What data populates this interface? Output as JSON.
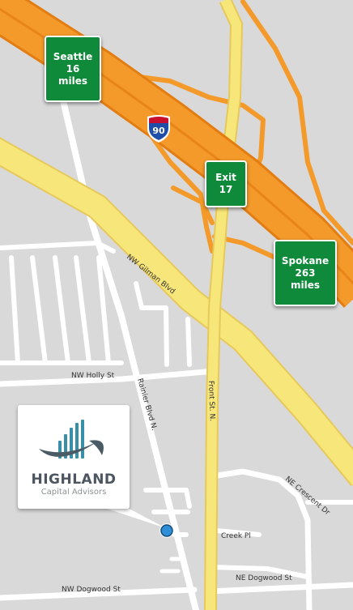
{
  "signs": {
    "seattle": {
      "line1": "Seattle",
      "line2": "16",
      "line3": "miles"
    },
    "exit": {
      "line1": "Exit",
      "line2": "17"
    },
    "spokane": {
      "line1": "Spokane",
      "line2": "263",
      "line3": "miles"
    },
    "interstate": {
      "number": "90"
    }
  },
  "streets": {
    "gilman": "NW Gilman Blvd",
    "holly": "NW Holly St",
    "rainier": "Rainier Blvd N.",
    "front": "Front St. N.",
    "crescent": "NE Crescent Dr",
    "creek": "Creek Pl",
    "dogwood_nw": "NW Dogwood St",
    "dogwood_ne": "NE Dogwood St"
  },
  "logo": {
    "name": "HIGHLAND",
    "subtitle": "Capital Advisors"
  },
  "colors": {
    "background": "#d9d9d9",
    "street": "#ffffff",
    "highway": "#f39a2a",
    "arterial": "#f7e67a",
    "sign_green": "#0f8a3b",
    "marker": "#2f8fd6",
    "logo_teal": "#3a8fa8"
  }
}
